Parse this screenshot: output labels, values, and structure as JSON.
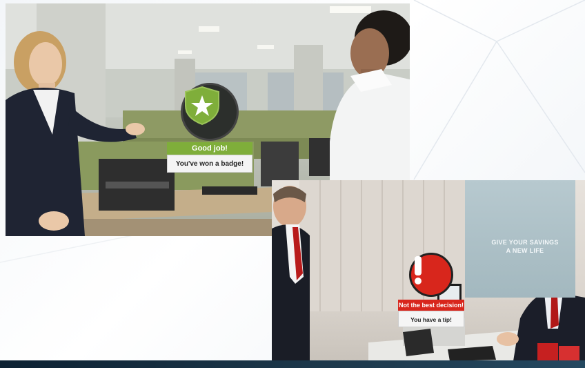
{
  "colors": {
    "success_green": "#7fae3a",
    "badge_dark": "#2c2f2c",
    "alert_red": "#d8261c",
    "bar_navy": "#0d2233"
  },
  "scene1": {
    "popup": {
      "icon": "shield-star-icon",
      "header": "Good job!",
      "body": "You've won a badge!"
    }
  },
  "scene2": {
    "poster": {
      "line1": "GIVE YOUR SAVINGS",
      "line2": "A NEW LIFE"
    },
    "popup": {
      "icon": "exclamation-icon",
      "header": "Not the best decision!",
      "body": "You have a tip!"
    }
  }
}
